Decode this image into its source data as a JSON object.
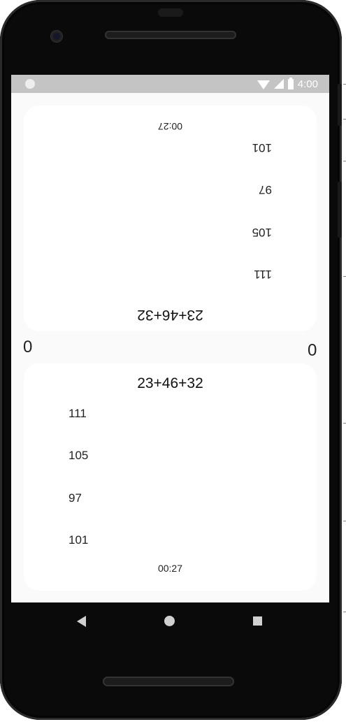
{
  "status_bar": {
    "time": "4:00"
  },
  "player_top": {
    "problem": "23+46+32",
    "answers": [
      "111",
      "105",
      "97",
      "101"
    ],
    "timer": "00:27",
    "score": "0"
  },
  "player_bottom": {
    "problem": "23+46+32",
    "answers": [
      "111",
      "105",
      "97",
      "101"
    ],
    "timer": "00:27",
    "score": "0"
  },
  "icons": {
    "status": [
      "wifi-icon",
      "signal-icon",
      "battery-icon"
    ],
    "navigation": [
      "back-icon",
      "home-icon",
      "recents-icon"
    ]
  }
}
